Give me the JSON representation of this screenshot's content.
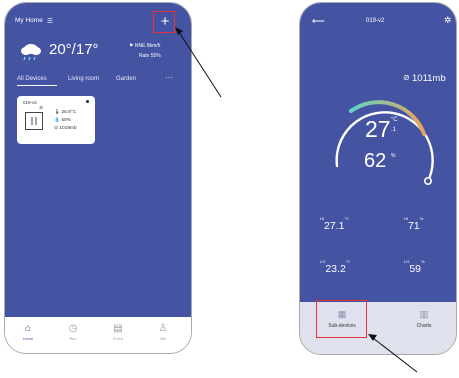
{
  "left_phone": {
    "header": {
      "title": "My Home",
      "menu_glyph": "☰",
      "add_label": "+"
    },
    "weather": {
      "icon": "cloud-rain-icon",
      "temp_range": "20°/17°",
      "wind": "NNE 8km/h",
      "rain": "Rain 55%"
    },
    "tabs": [
      "All Devices",
      "Living room",
      "Garden",
      "···"
    ],
    "device_card": {
      "name": "019-v2",
      "temperature": "26.8°C",
      "humidity": "50%",
      "pressure": "1019mb"
    },
    "nav": [
      {
        "label": "Home",
        "icon": "home-icon"
      },
      {
        "label": "Run",
        "icon": "run-icon"
      },
      {
        "label": "Event",
        "icon": "event-icon"
      },
      {
        "label": "Me",
        "icon": "user-icon"
      }
    ]
  },
  "right_phone": {
    "header": {
      "back": "⟵",
      "device_name": "019-v2",
      "settings": "✲"
    },
    "pressure": "1011mb",
    "gauge": {
      "temperature": "27",
      "temp_unit": "°C",
      "temp_decimal": ".1",
      "humidity": "62",
      "humid_unit": "%"
    },
    "stats": {
      "hi_label": "HI",
      "lo_label": "LO",
      "hi_temp": "27.1",
      "hi_temp_unit": "°C",
      "hi_humid": "71",
      "hi_humid_unit": "%",
      "lo_temp": "23.2",
      "lo_temp_unit": "°C",
      "lo_humid": "59",
      "lo_humid_unit": "%"
    },
    "nav": [
      {
        "label": "Sub-devices",
        "icon": "grid-icon"
      },
      {
        "label": "Charts",
        "icon": "bar-chart-icon"
      }
    ]
  },
  "colors": {
    "screen_bg": "#4454a3",
    "highlight": "#e8323a",
    "gauge_start": "#5fd4c8",
    "gauge_end": "#e9a45a"
  }
}
